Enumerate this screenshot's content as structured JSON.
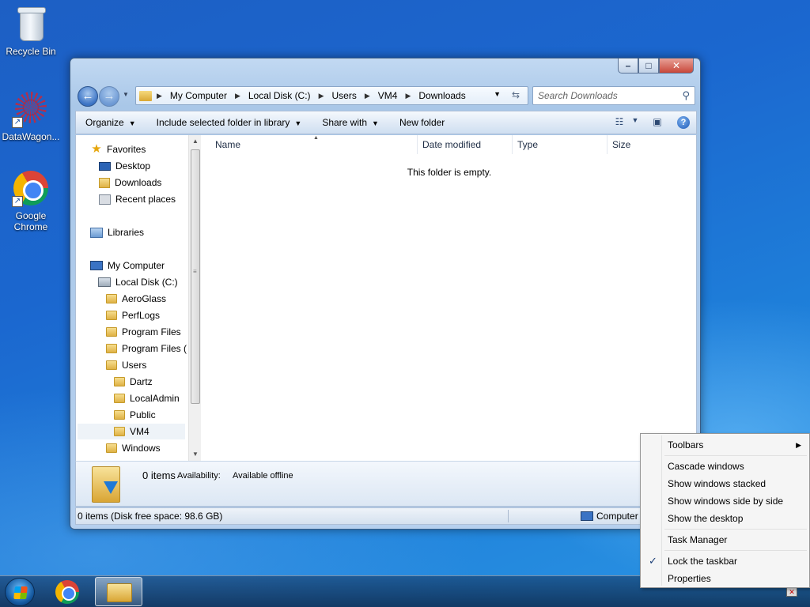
{
  "desktop": {
    "icons": [
      {
        "label": "Recycle Bin"
      },
      {
        "label": "DataWagon..."
      },
      {
        "label": "Google Chrome"
      }
    ]
  },
  "window": {
    "caption": {
      "minimize": "–",
      "maximize": "□",
      "close": "✕"
    },
    "address": {
      "crumbs": [
        "My Computer",
        "Local Disk (C:)",
        "Users",
        "VM4",
        "Downloads"
      ]
    },
    "search": {
      "placeholder": "Search Downloads"
    },
    "toolbar": {
      "organize": "Organize",
      "include": "Include selected folder in library",
      "share": "Share with",
      "new_folder": "New folder"
    },
    "nav_pane": {
      "favorites": "Favorites",
      "desktop": "Desktop",
      "downloads": "Downloads",
      "recent": "Recent places",
      "libraries": "Libraries",
      "my_computer": "My Computer",
      "local_disk": "Local Disk (C:)",
      "folders": [
        "AeroGlass",
        "PerfLogs",
        "Program Files",
        "Program Files (",
        "Users"
      ],
      "user_folders": [
        "Dartz",
        "LocalAdmin",
        "Public",
        "VM4"
      ],
      "windows": "Windows"
    },
    "columns": [
      "Name",
      "Date modified",
      "Type",
      "Size"
    ],
    "empty_message": "This folder is empty.",
    "details": {
      "count": "0 items",
      "availability_label": "Availability:",
      "availability_value": "Available offline"
    },
    "status": {
      "left": "0 items (Disk free space: 98.6 GB)",
      "right": "Computer"
    }
  },
  "context_menu": {
    "toolbars": "Toolbars",
    "cascade": "Cascade windows",
    "stacked": "Show windows stacked",
    "side_by_side": "Show windows side by side",
    "show_desktop": "Show the desktop",
    "task_manager": "Task Manager",
    "lock_taskbar": "Lock the taskbar",
    "properties": "Properties",
    "check_mark": "✓"
  }
}
